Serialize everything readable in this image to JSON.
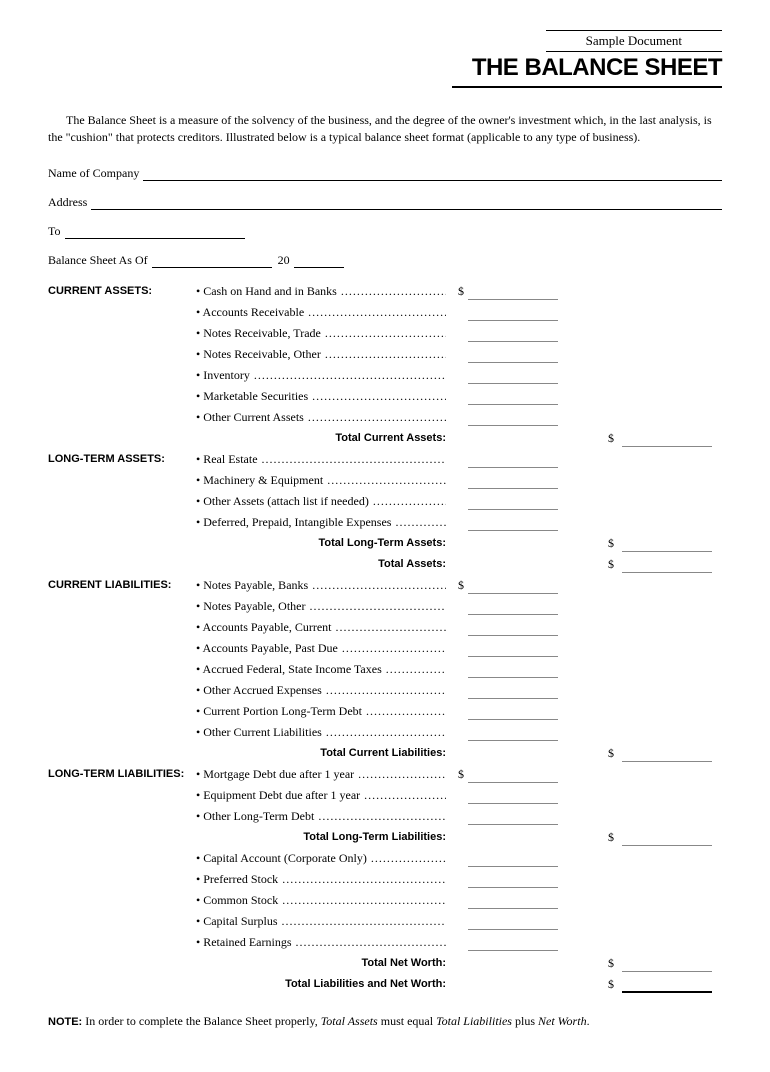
{
  "header": {
    "sample": "Sample Document",
    "title": "THE BALANCE SHEET"
  },
  "intro": "The Balance Sheet is a measure of the solvency of the business, and the degree of the owner's investment which, in the last analysis, is the \"cushion\" that protects creditors. Illustrated below is a typical balance sheet format (applicable to any type of business).",
  "fields": {
    "company": "Name of Company",
    "address": "Address",
    "to": "To",
    "as_of": "Balance Sheet As Of",
    "century": "20"
  },
  "sections": {
    "current_assets": {
      "heading": "CURRENT ASSETS:",
      "items": [
        "Cash on Hand and in Banks",
        "Accounts Receivable",
        "Notes Receivable, Trade",
        "Notes Receivable, Other",
        "Inventory",
        "Marketable Securities",
        "Other Current Assets"
      ],
      "total": "Total Current Assets:"
    },
    "long_term_assets": {
      "heading": "LONG-TERM ASSETS:",
      "items": [
        "Real Estate",
        "Machinery & Equipment",
        "Other Assets (attach list if needed)",
        "Deferred, Prepaid, Intangible Expenses"
      ],
      "total": "Total Long-Term Assets:",
      "grand_total": "Total Assets:"
    },
    "current_liabilities": {
      "heading": "CURRENT LIABILITIES:",
      "items": [
        "Notes Payable, Banks",
        "Notes Payable, Other",
        "Accounts Payable, Current",
        "Accounts Payable, Past Due",
        "Accrued Federal, State Income Taxes",
        "Other Accrued Expenses",
        "Current Portion Long-Term Debt",
        "Other Current Liabilities"
      ],
      "total": "Total Current Liabilities:"
    },
    "long_term_liabilities": {
      "heading": "LONG-TERM LIABILITIES:",
      "items": [
        "Mortgage Debt due after 1 year",
        "Equipment Debt due after 1 year",
        "Other Long-Term Debt"
      ],
      "total": "Total Long-Term Liabilities:"
    },
    "equity": {
      "items": [
        "Capital Account (Corporate Only)",
        "Preferred Stock",
        "Common Stock",
        "Capital Surplus",
        "Retained Earnings"
      ],
      "total": "Total Net Worth:",
      "grand_total": "Total Liabilities and Net Worth:"
    }
  },
  "note": {
    "label": "NOTE:",
    "text_1": " In order to complete the Balance Sheet properly, ",
    "italic_1": "Total Assets",
    "text_2": " must equal ",
    "italic_2": "Total Liabilities",
    "text_3": " plus ",
    "italic_3": "Net Worth",
    "text_4": "."
  },
  "dollar": "$"
}
